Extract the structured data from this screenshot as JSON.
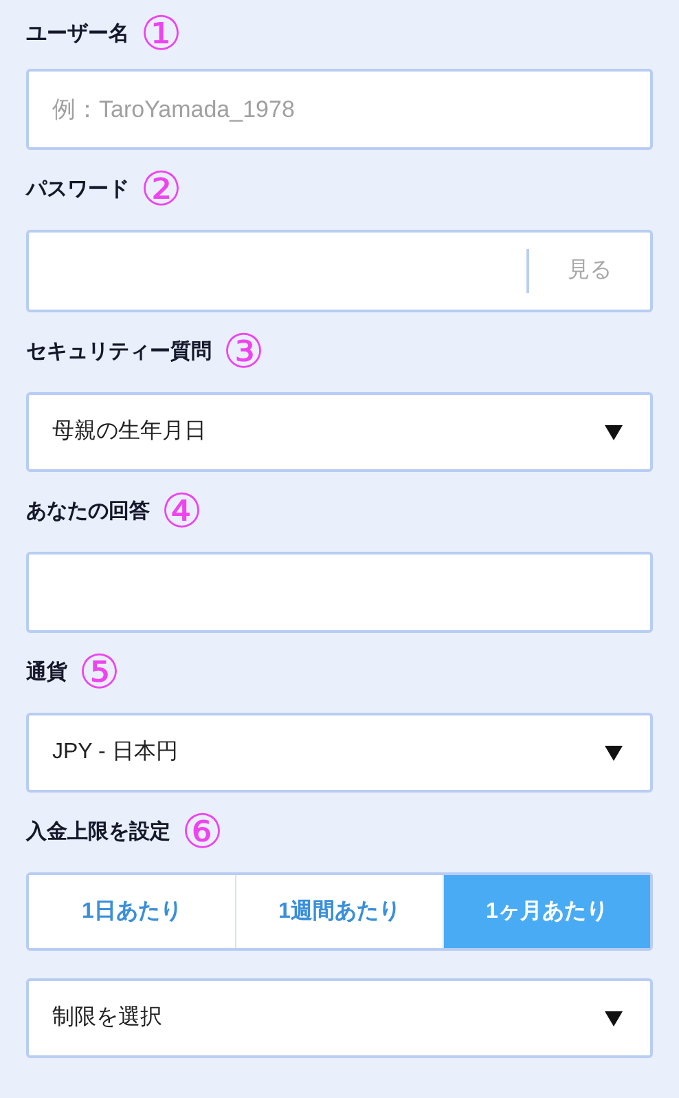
{
  "sections": [
    {
      "label": "ユーザー名",
      "number": "①",
      "kind": "text",
      "placeholder": "例：TaroYamada_1978"
    },
    {
      "label": "パスワード",
      "number": "②",
      "kind": "password",
      "button": "見る"
    },
    {
      "label": "セキュリティー質問",
      "number": "③",
      "kind": "select",
      "value": "母親の生年月日"
    },
    {
      "label": "あなたの回答",
      "number": "④",
      "kind": "text"
    },
    {
      "label": "通貨",
      "number": "⑤",
      "kind": "select",
      "value": "JPY - 日本円"
    },
    {
      "label": "入金上限を設定",
      "number": "⑥",
      "kind": "tabs",
      "options": [
        {
          "label": "1日あたり",
          "selected": false
        },
        {
          "label": "1週間あたり",
          "selected": false
        },
        {
          "label": "1ヶ月あたり",
          "selected": true
        }
      ]
    },
    {
      "kind": "select",
      "value": "制限を選択"
    }
  ]
}
